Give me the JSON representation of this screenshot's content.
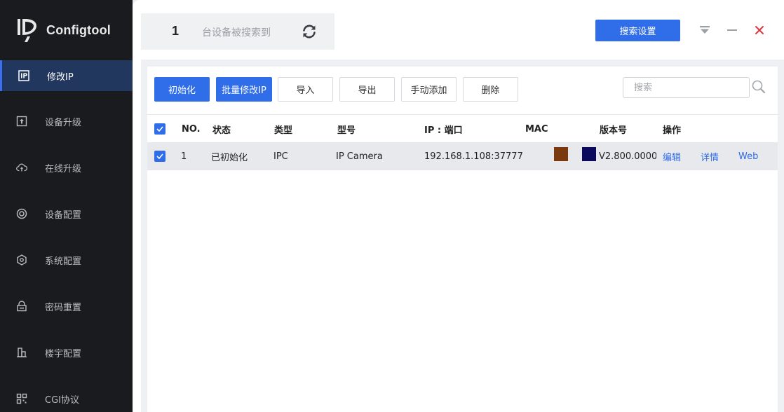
{
  "app": {
    "name": "Configtool"
  },
  "sidebar": {
    "items": [
      {
        "label": "修改IP",
        "icon": "ip-icon",
        "active": true
      },
      {
        "label": "设备升级",
        "icon": "upload-icon",
        "active": false
      },
      {
        "label": "在线升级",
        "icon": "cloud-upload-icon",
        "active": false
      },
      {
        "label": "设备配置",
        "icon": "target-icon",
        "active": false
      },
      {
        "label": "系统配置",
        "icon": "hexagon-gear-icon",
        "active": false
      },
      {
        "label": "密码重置",
        "icon": "lock-box-icon",
        "active": false
      },
      {
        "label": "楼宇配置",
        "icon": "building-icon",
        "active": false
      },
      {
        "label": "CGI协议",
        "icon": "qr-grid-icon",
        "active": false
      }
    ]
  },
  "header": {
    "device_count": "1",
    "device_count_text": "台设备被搜索到",
    "search_settings_label": "搜索设置"
  },
  "toolbar": {
    "init_label": "初始化",
    "batch_modify_label": "批量修改IP",
    "import_label": "导入",
    "export_label": "导出",
    "manual_add_label": "手动添加",
    "delete_label": "删除",
    "search_placeholder": "搜索"
  },
  "table": {
    "columns": [
      "NO.",
      "状态",
      "类型",
      "型号",
      "IP : 端口",
      "MAC",
      "版本号",
      "操作"
    ],
    "rows": [
      {
        "no": "1",
        "status": "已初始化",
        "type": "IPC",
        "model": "IP Camera",
        "ip_port": "192.168.1.108:37777",
        "mac_swatch_colors": [
          "#7b3a0e",
          "#0c0a5c"
        ],
        "version": "V2.800.0000...",
        "actions": [
          "编辑",
          "详情",
          "Web"
        ]
      }
    ]
  },
  "colors": {
    "accent": "#2f6de9",
    "sidebar_bg": "#191b1e",
    "sidebar_active_bg": "#22375e",
    "close_red": "#e0373c"
  }
}
